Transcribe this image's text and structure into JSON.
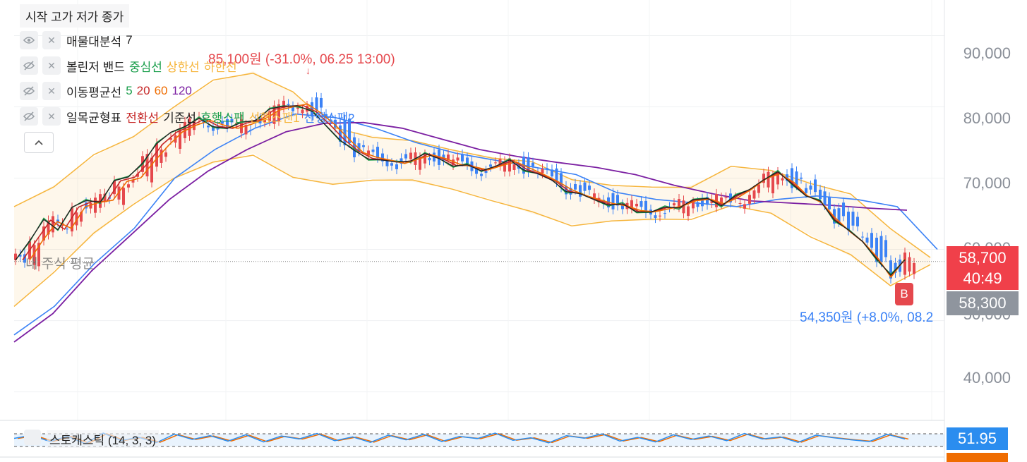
{
  "legend": {
    "ohlc_title": "시작 고가 저가 종가",
    "volume_profile": {
      "name": "매물대분석",
      "param": "7"
    },
    "bollinger": {
      "name": "볼린저 밴드",
      "center": "중심선",
      "upper": "상한선",
      "lower": "하한선"
    },
    "moving_average": {
      "name": "이동평균선",
      "p5": "5",
      "p20": "20",
      "p60": "60",
      "p120": "120"
    },
    "ichimoku": {
      "name": "일목균형표",
      "conversion": "전환선",
      "base": "기준선",
      "lagging": "후행스팬",
      "span1": "선행스팬1",
      "span2": "선행스팬2"
    }
  },
  "icons": {
    "visible": "eye-icon",
    "hidden": "eye-off-icon",
    "remove": "close-icon",
    "collapse": "chevron-up-icon"
  },
  "annotations": {
    "max": "85,100원 (-31.0%, 06.25 13:00)",
    "min": "54,350원 (+8.0%, 08.2",
    "avg_line": "내 주식 평균",
    "buy_marker": "B"
  },
  "price_boxes": {
    "current": "58,700",
    "countdown": "40:49",
    "avg": "58,300"
  },
  "stochastic": {
    "label": "스토캐스틱 (14, 3, 3)",
    "value": "51.95"
  },
  "colors": {
    "up": "#e5484d",
    "down": "#3b82f6",
    "ma5": "#1a9e4b",
    "ma20": "#c62828",
    "ma60": "#ef6c00",
    "ma120": "#7b1fa2",
    "bb_center": "#1a9e4b",
    "bb_band": "#f6b53c",
    "conversion": "#c62828",
    "base": "#222222",
    "lagging": "#1a9e4b",
    "span1": "#f6b53c",
    "span2": "#3b82f6",
    "stoch_k": "#2b8def",
    "stoch_d": "#ef6c00"
  },
  "chart_data": {
    "type": "line",
    "y_axis_ticks": [
      "90,000",
      "80,000",
      "70,000",
      "60,000",
      "50,000",
      "40,000"
    ],
    "ylim": [
      36000,
      95000
    ],
    "close_series": [
      58500,
      61500,
      63800,
      63000,
      66000,
      66500,
      67000,
      69500,
      70000,
      72500,
      74500,
      76500,
      77500,
      78000,
      77500,
      77000,
      77500,
      78500,
      79500,
      80000,
      80500,
      79000,
      77500,
      75500,
      73500,
      73000,
      72500,
      72000,
      72800,
      73200,
      72700,
      72000,
      71500,
      71200,
      71800,
      72200,
      71500,
      70500,
      69500,
      68500,
      67500,
      67000,
      66500,
      66000,
      65500,
      65300,
      65600,
      66200,
      66800,
      67000,
      66500,
      67200,
      68500,
      70000,
      70500,
      69500,
      67500,
      66500,
      64500,
      62500,
      61000,
      59000,
      56000,
      58700
    ],
    "ma120_series": [
      47000,
      51000,
      57000,
      62000,
      67000,
      71000,
      74000,
      76500,
      77700,
      77800,
      77000,
      75500,
      74000,
      73000,
      72200,
      71500,
      70500,
      69000,
      67800,
      66800,
      66500,
      66200,
      65800,
      65500
    ],
    "bb_upper": [
      66000,
      69000,
      73000,
      76000,
      80000,
      83500,
      85000,
      82000,
      77000,
      76000,
      75000,
      74000,
      73000,
      72000,
      70000,
      69000,
      68500,
      69000,
      71500,
      71000,
      69500,
      67500,
      63000,
      59000
    ],
    "bb_lower": [
      52000,
      57000,
      62000,
      66500,
      70000,
      72000,
      73500,
      70000,
      69000,
      70000,
      69500,
      68500,
      67000,
      65000,
      63500,
      64000,
      64000,
      64500,
      66000,
      65000,
      62000,
      59000,
      55000,
      58000
    ],
    "span2_series": [
      48000,
      52000,
      58000,
      63000,
      70000,
      74000,
      77000,
      79000,
      78500,
      77000,
      75000,
      73500,
      72500,
      71500,
      70500,
      68000,
      67000,
      66500,
      66000,
      67000,
      67500,
      67000,
      66000,
      60000
    ],
    "max_label": "85,100원",
    "min_label": "54,350원",
    "current_price": 58700,
    "avg_price": 58300,
    "stochastic_k": [
      55,
      70,
      40,
      65,
      30,
      80,
      45,
      60,
      35,
      75,
      50,
      68,
      42,
      72,
      38,
      66,
      52,
      78,
      44,
      62,
      36,
      70,
      48,
      74,
      40,
      64,
      54,
      80,
      46,
      58,
      34,
      68,
      56,
      76,
      42,
      60,
      38,
      72,
      50,
      66,
      44,
      78,
      52,
      62,
      36,
      70,
      58,
      48,
      40,
      74,
      52
    ],
    "stoch_value": 51.95
  }
}
